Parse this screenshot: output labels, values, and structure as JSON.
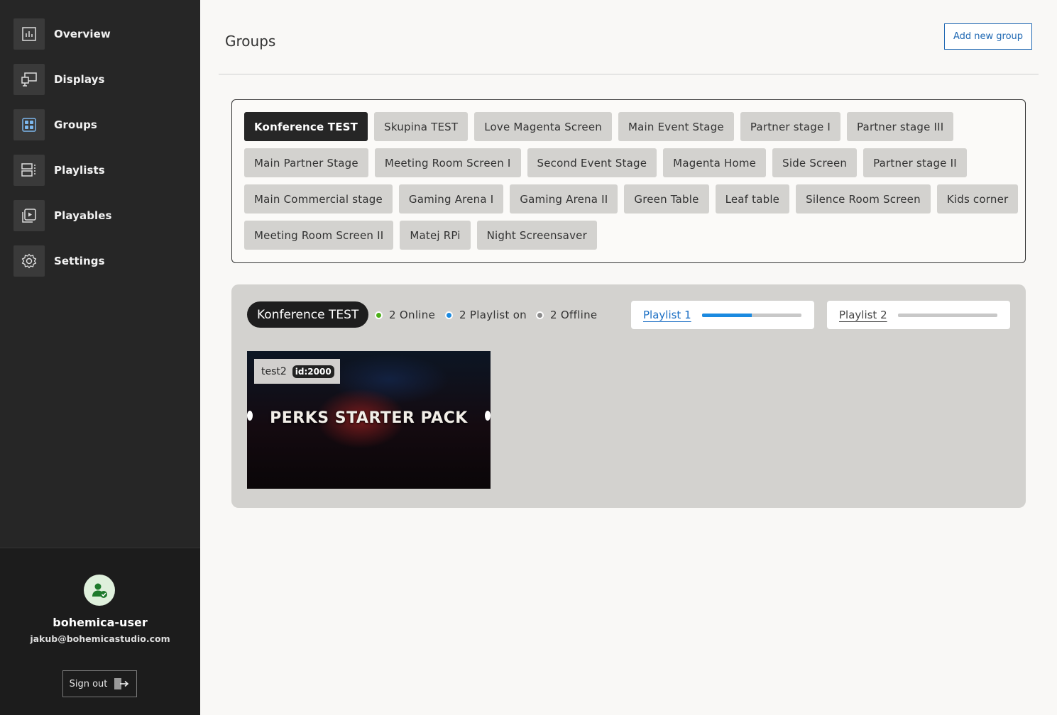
{
  "sidebar": {
    "items": [
      {
        "label": "Overview",
        "icon": "chart-icon"
      },
      {
        "label": "Displays",
        "icon": "display-icon"
      },
      {
        "label": "Groups",
        "icon": "groups-icon"
      },
      {
        "label": "Playlists",
        "icon": "playlists-icon"
      },
      {
        "label": "Playables",
        "icon": "playables-icon"
      },
      {
        "label": "Settings",
        "icon": "gear-icon"
      }
    ],
    "active": "Groups",
    "user": {
      "name": "bohemica-user",
      "email": "jakub@bohemicastudio.com",
      "sign_out": "Sign out"
    }
  },
  "header": {
    "title": "Groups",
    "add_button": "Add new group"
  },
  "groups": {
    "rows": [
      [
        "Konference TEST",
        "Skupina TEST",
        "Love Magenta Screen",
        "Main Event Stage",
        "Partner stage I",
        "Partner stage III"
      ],
      [
        "Main Partner Stage",
        "Meeting Room Screen I",
        "Second Event Stage",
        "Magenta Home",
        "Side Screen",
        "Partner stage II"
      ],
      [
        "Main Commercial stage",
        "Gaming Arena I",
        "Gaming Arena II",
        "Green Table",
        "Leaf table",
        "Silence Room Screen",
        "Kids corner"
      ],
      [
        "Meeting Room Screen II",
        "Matej RPi",
        "Night Screensaver"
      ]
    ],
    "selected": "Konference TEST"
  },
  "detail": {
    "group_name": "Konference TEST",
    "online": "2 Online",
    "playlist_on": "2 Playlist on",
    "offline": "2 Offline",
    "playlists": [
      {
        "label": "Playlist 1",
        "progress": 0.5,
        "color": "#1b6fc4"
      },
      {
        "label": "Playlist 2",
        "progress": 0,
        "color": "#444444"
      }
    ],
    "display": {
      "name": "test2",
      "id": "id:2000",
      "thumbnail_text": "PERKS STARTER PACK"
    }
  },
  "colors": {
    "online": "#4caf1a",
    "playlist_on": "#1b8ae0",
    "offline": "#8a8a8a",
    "accent": "#1f68b3"
  }
}
